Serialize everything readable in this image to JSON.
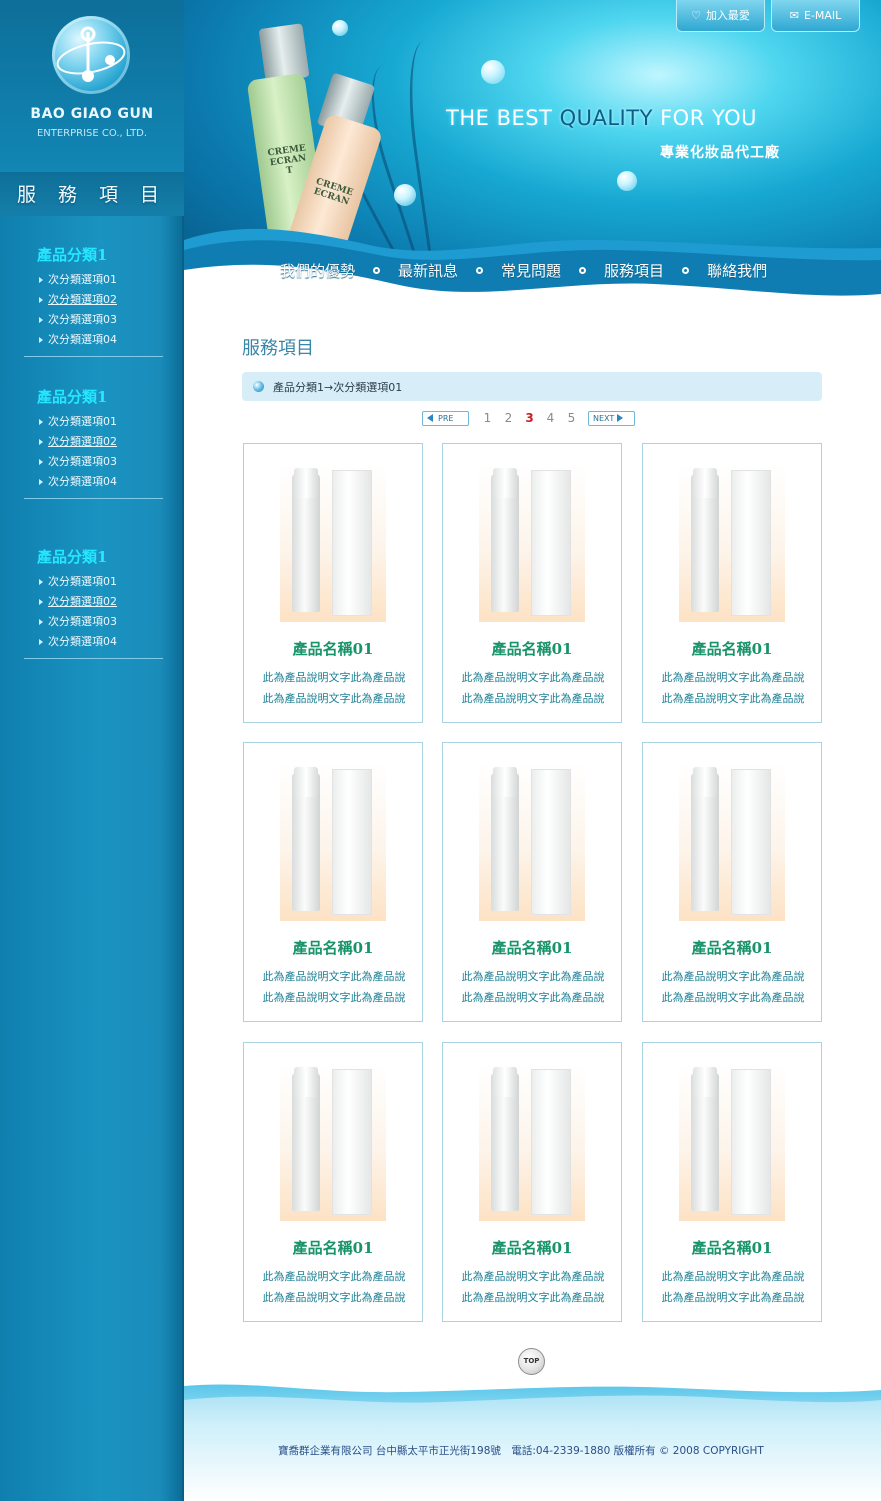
{
  "brand": {
    "name": "BAO GIAO GUN",
    "subtitle": "ENTERPRISE CO., LTD."
  },
  "sidebar": {
    "heading": "服 務 項 目",
    "categories": [
      {
        "title": "產品分類1",
        "items": [
          "次分類選項01",
          "次分類選項02",
          "次分類選項03",
          "次分類選項04"
        ]
      },
      {
        "title": "產品分類1",
        "items": [
          "次分類選項01",
          "次分類選項02",
          "次分類選項03",
          "次分類選項04"
        ]
      },
      {
        "title": "產品分類1",
        "items": [
          "次分類選項01",
          "次分類選項02",
          "次分類選項03",
          "次分類選項04"
        ]
      }
    ]
  },
  "header": {
    "favorite_label": "加入最愛",
    "email_label": "E-MAIL",
    "slogan_part1": "THE BEST ",
    "slogan_highlight": "QUALITY",
    "slogan_part2": " FOR YOU",
    "slogan_sub": "專業化妝品代工廠",
    "bottle_label_1": "CREME ECRAN T",
    "bottle_label_2": "CREME ECRAN"
  },
  "nav": {
    "items": [
      "我們的優勢",
      "最新訊息",
      "常見問題",
      "服務項目",
      "聯絡我們"
    ]
  },
  "main": {
    "title": "服務項目",
    "breadcrumb": "產品分類1→次分類選項01",
    "pager": {
      "prev": "PRE",
      "next": "NEXT",
      "pages": [
        "1",
        "2",
        "3",
        "4",
        "5"
      ],
      "current": "3"
    },
    "products": [
      {
        "name": "產品名稱01",
        "desc1": "此為產品說明文字此為產品說",
        "desc2": "此為產品說明文字此為產品說"
      },
      {
        "name": "產品名稱01",
        "desc1": "此為產品說明文字此為產品說",
        "desc2": "此為產品說明文字此為產品說"
      },
      {
        "name": "產品名稱01",
        "desc1": "此為產品說明文字此為產品說",
        "desc2": "此為產品說明文字此為產品說"
      },
      {
        "name": "產品名稱01",
        "desc1": "此為產品說明文字此為產品說",
        "desc2": "此為產品說明文字此為產品說"
      },
      {
        "name": "產品名稱01",
        "desc1": "此為產品說明文字此為產品說",
        "desc2": "此為產品說明文字此為產品說"
      },
      {
        "name": "產品名稱01",
        "desc1": "此為產品說明文字此為產品說",
        "desc2": "此為產品說明文字此為產品說"
      },
      {
        "name": "產品名稱01",
        "desc1": "此為產品說明文字此為產品說",
        "desc2": "此為產品說明文字此為產品說"
      },
      {
        "name": "產品名稱01",
        "desc1": "此為產品說明文字此為產品說",
        "desc2": "此為產品說明文字此為產品說"
      },
      {
        "name": "產品名稱01",
        "desc1": "此為產品說明文字此為產品說",
        "desc2": "此為產品說明文字此為產品說"
      }
    ],
    "top_label": "TOP"
  },
  "footer": {
    "text": "寶喬群企業有限公司 台中縣太平市正光街198號　電話:04-2339-1880  版權所有 © 2008 COPYRIGHT"
  },
  "colors": {
    "sidebar": "#1a8cba",
    "category_title": "#25e7ff",
    "product_name": "#19936a",
    "product_desc": "#1c7f93",
    "active_page": "#cc2020",
    "footer_text": "#2a4f88"
  },
  "icons": {
    "favorite": "heart-icon",
    "email": "envelope-icon",
    "breadcrumb": "globe-dot-icon",
    "prev": "triangle-left-icon",
    "next": "triangle-right-icon"
  }
}
